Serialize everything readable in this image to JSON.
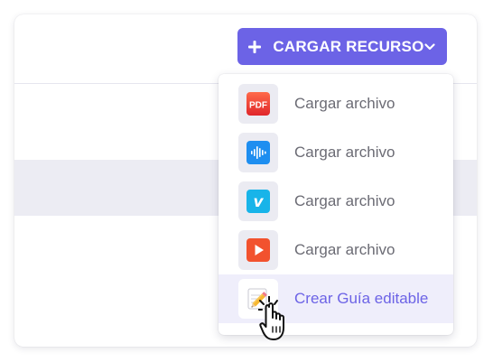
{
  "toolbar": {
    "upload_button_label": "CARGAR RECURSO",
    "upload_button_color": "#6c63e6"
  },
  "menu": {
    "items": [
      {
        "label": "Cargar archivo",
        "icon": "pdf-icon"
      },
      {
        "label": "Cargar archivo",
        "icon": "audio-icon"
      },
      {
        "label": "Cargar archivo",
        "icon": "vimeo-icon"
      },
      {
        "label": "Cargar archivo",
        "icon": "video-play-icon"
      },
      {
        "label": "Crear Guía editable",
        "icon": "pencil-notepad-icon",
        "highlighted": true
      }
    ],
    "icon_texts": {
      "pdf": "PDF",
      "vimeo": "v"
    },
    "highlight_color": "#efeefb",
    "accent_color": "#6c63e6"
  },
  "pointer": {
    "icon": "hand-pointer-cursor"
  }
}
